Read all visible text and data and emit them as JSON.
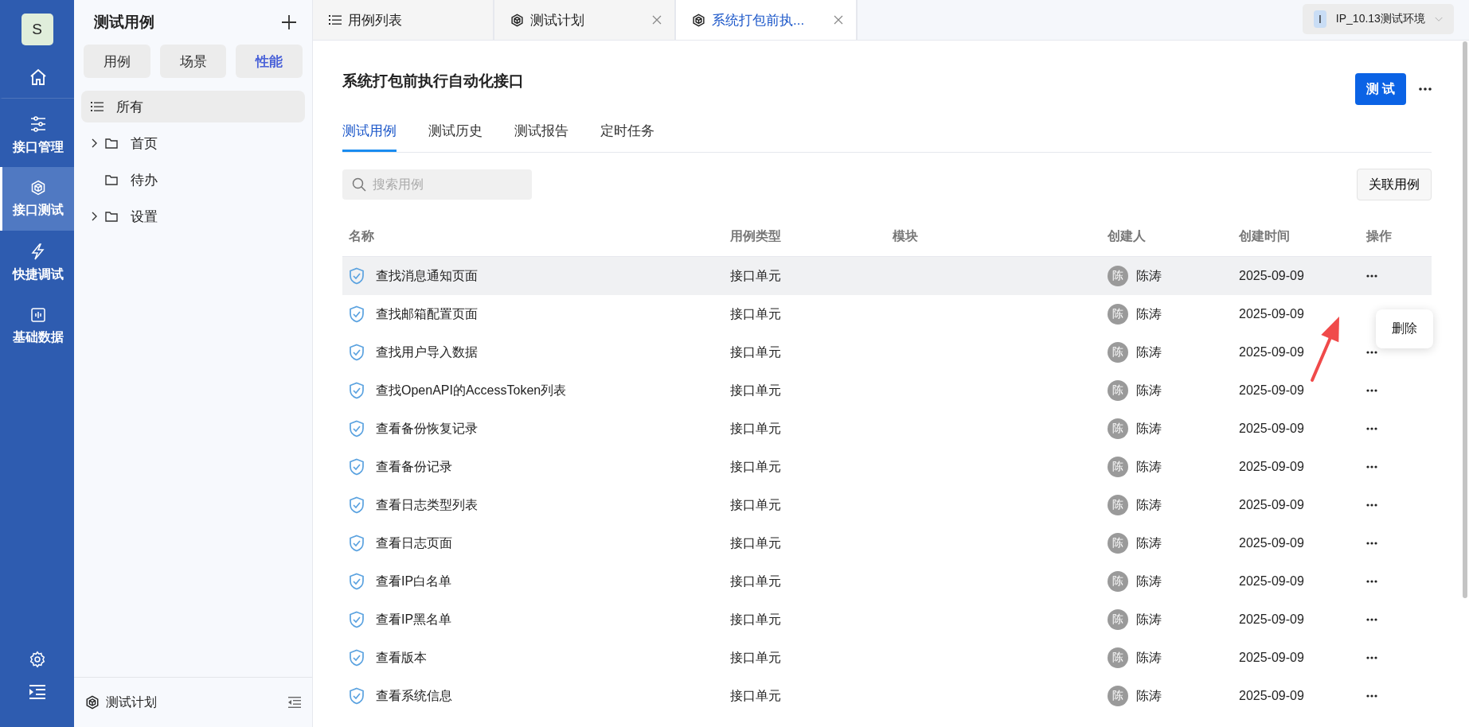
{
  "rail": {
    "avatar": "S",
    "items": [
      {
        "kind": "home",
        "selected": false
      },
      {
        "kind": "sliders",
        "label": "接口管理",
        "selected": false
      },
      {
        "kind": "cube",
        "label": "接口测试",
        "selected": true
      },
      {
        "kind": "bolt",
        "label": "快捷调试",
        "selected": false
      },
      {
        "kind": "wave",
        "label": "基础数据",
        "selected": false
      }
    ]
  },
  "sidebar": {
    "title": "测试用例",
    "segments": [
      {
        "label": "用例",
        "selected": false
      },
      {
        "label": "场景",
        "selected": false
      },
      {
        "label": "性能",
        "selected": true
      }
    ],
    "tree": [
      {
        "kind": "all",
        "label": "所有",
        "selected": true
      },
      {
        "kind": "folder",
        "label": "首页",
        "selected": false,
        "expandable": true,
        "expanded": false
      },
      {
        "kind": "folder",
        "label": "待办",
        "selected": false,
        "expandable": false
      },
      {
        "kind": "folder",
        "label": "设置",
        "selected": false,
        "expandable": true,
        "expanded": false
      }
    ],
    "footer": "测试计划"
  },
  "tabs": [
    {
      "kind": "list",
      "label": "用例列表",
      "selected": false,
      "closable": false
    },
    {
      "kind": "cube",
      "label": "测试计划",
      "selected": false,
      "closable": true
    },
    {
      "kind": "cube",
      "label": "系统打包前执...",
      "selected": true,
      "closable": true
    }
  ],
  "environment": {
    "badge": "I",
    "label": "IP_10.13测试环境"
  },
  "page": {
    "title": "系统打包前执行自动化接口",
    "test_button": "测 试",
    "tabs": [
      {
        "label": "测试用例",
        "selected": true
      },
      {
        "label": "测试历史",
        "selected": false
      },
      {
        "label": "测试报告",
        "selected": false
      },
      {
        "label": "定时任务",
        "selected": false
      }
    ],
    "search": {
      "placeholder": "搜索用例"
    },
    "link_button": "关联用例"
  },
  "table": {
    "columns": [
      "名称",
      "用例类型",
      "模块",
      "创建人",
      "创建时间",
      "操作"
    ],
    "rows": [
      {
        "name": "查找消息通知页面",
        "type": "接口单元",
        "avatar": "陈",
        "creator": "陈涛",
        "date": "2025-09-09",
        "hovered": true
      },
      {
        "name": "查找邮箱配置页面",
        "type": "接口单元",
        "avatar": "陈",
        "creator": "陈涛",
        "date": "2025-09-09",
        "hovered": false,
        "menu": [
          "删除"
        ]
      },
      {
        "name": "查找用户导入数据",
        "type": "接口单元",
        "avatar": "陈",
        "creator": "陈涛",
        "date": "2025-09-09",
        "hovered": false
      },
      {
        "name": "查找OpenAPI的AccessToken列表",
        "type": "接口单元",
        "avatar": "陈",
        "creator": "陈涛",
        "date": "2025-09-09",
        "hovered": false
      },
      {
        "name": "查看备份恢复记录",
        "type": "接口单元",
        "avatar": "陈",
        "creator": "陈涛",
        "date": "2025-09-09",
        "hovered": false
      },
      {
        "name": "查看备份记录",
        "type": "接口单元",
        "avatar": "陈",
        "creator": "陈涛",
        "date": "2025-09-09",
        "hovered": false
      },
      {
        "name": "查看日志类型列表",
        "type": "接口单元",
        "avatar": "陈",
        "creator": "陈涛",
        "date": "2025-09-09",
        "hovered": false
      },
      {
        "name": "查看日志页面",
        "type": "接口单元",
        "avatar": "陈",
        "creator": "陈涛",
        "date": "2025-09-09",
        "hovered": false
      },
      {
        "name": "查看IP白名单",
        "type": "接口单元",
        "avatar": "陈",
        "creator": "陈涛",
        "date": "2025-09-09",
        "hovered": false
      },
      {
        "name": "查看IP黑名单",
        "type": "接口单元",
        "avatar": "陈",
        "creator": "陈涛",
        "date": "2025-09-09",
        "hovered": false
      },
      {
        "name": "查看版本",
        "type": "接口单元",
        "avatar": "陈",
        "creator": "陈涛",
        "date": "2025-09-09",
        "hovered": false
      },
      {
        "name": "查看系统信息",
        "type": "接口单元",
        "avatar": "陈",
        "creator": "陈涛",
        "date": "2025-09-09",
        "hovered": false
      }
    ]
  }
}
